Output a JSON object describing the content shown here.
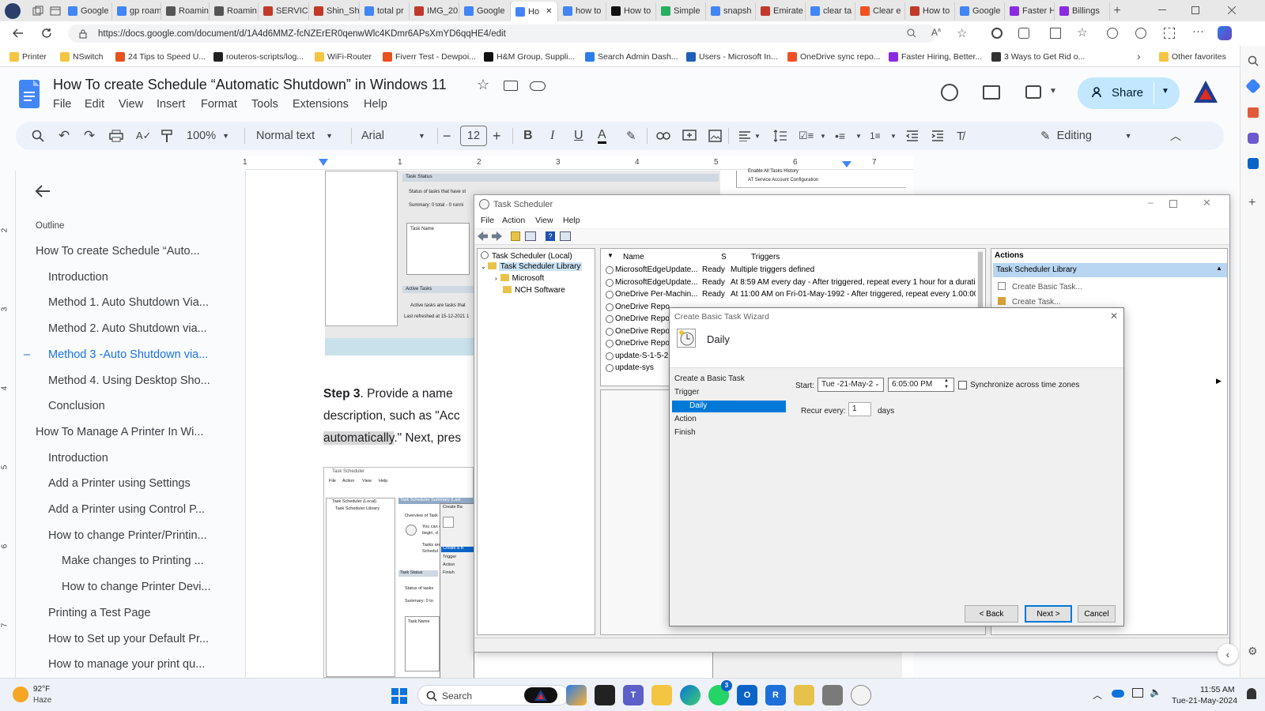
{
  "browser": {
    "tabs": [
      {
        "label": "Google"
      },
      {
        "label": "gp roam"
      },
      {
        "label": "Roamin"
      },
      {
        "label": "Roamin"
      },
      {
        "label": "SERVIC"
      },
      {
        "label": "Shin_Sh"
      },
      {
        "label": "total pr"
      },
      {
        "label": "IMG_20"
      },
      {
        "label": "Google"
      },
      {
        "label": "Ho"
      },
      {
        "label": "how to"
      },
      {
        "label": "How to"
      },
      {
        "label": "Simple"
      },
      {
        "label": "snapsh"
      },
      {
        "label": "Emirate"
      },
      {
        "label": "clear ta"
      },
      {
        "label": "Clear e"
      },
      {
        "label": "How to"
      },
      {
        "label": "Google"
      },
      {
        "label": "Faster H"
      },
      {
        "label": "Billings"
      }
    ],
    "url": "https://docs.google.com/document/d/1A4d6MMZ-fcNZErER0qenwWlc4KDmr6APsXmYD6qqHE4/edit",
    "bookmarks": [
      {
        "label": "Printer",
        "color": "#f4c542"
      },
      {
        "label": "NSwitch",
        "color": "#f4c542"
      },
      {
        "label": "24 Tips to Speed U...",
        "color": "#e8511b"
      },
      {
        "label": "routeros-scripts/log...",
        "color": "#222222"
      },
      {
        "label": "WiFi-Router",
        "color": "#f4c542"
      },
      {
        "label": "Fiverr Test - Dewpoi...",
        "color": "#e8511b"
      },
      {
        "label": "H&M Group, Suppli...",
        "color": "#111111"
      },
      {
        "label": "Search Admin Dash...",
        "color": "#2b7de9"
      },
      {
        "label": "Users - Microsoft In...",
        "color": "#1e5fb8"
      },
      {
        "label": "OneDrive sync repo...",
        "color": "#f25022"
      },
      {
        "label": "Faster Hiring, Better...",
        "color": "#8a2be2"
      },
      {
        "label": "3 Ways to Get Rid o...",
        "color": "#333333"
      }
    ],
    "other_favorites": "Other favorites"
  },
  "doc": {
    "title": "How To create Schedule “Automatic Shutdown” in Windows 11",
    "menu": [
      "File",
      "Edit",
      "View",
      "Insert",
      "Format",
      "Tools",
      "Extensions",
      "Help"
    ],
    "share": "Share",
    "zoom": "100%",
    "style": "Normal text",
    "font": "Arial",
    "font_size": "12",
    "mode": "Editing",
    "ruler_numbers": [
      "1",
      "1",
      "2",
      "3",
      "4",
      "5",
      "6",
      "7"
    ],
    "vruler_numbers": [
      "2",
      "3",
      "4",
      "5",
      "6",
      "7"
    ]
  },
  "outline": {
    "heading": "Outline",
    "items": [
      {
        "label": "How To create Schedule “Auto...",
        "level": 1
      },
      {
        "label": "Introduction",
        "level": 2
      },
      {
        "label": "Method 1. Auto Shutdown Via...",
        "level": 2
      },
      {
        "label": "Method 2. Auto Shutdown via...",
        "level": 2
      },
      {
        "label": "Method 3 -Auto Shutdown via...",
        "level": 2,
        "active": true
      },
      {
        "label": "Method 4. Using Desktop Sho...",
        "level": 2
      },
      {
        "label": "Conclusion",
        "level": 2
      },
      {
        "label": "How To Manage A Printer In Wi...",
        "level": 1
      },
      {
        "label": "Introduction",
        "level": 2
      },
      {
        "label": "Add a Printer using Settings",
        "level": 2
      },
      {
        "label": "Add a Printer using Control P...",
        "level": 2
      },
      {
        "label": "How to change Printer/Printin...",
        "level": 2
      },
      {
        "label": "Make changes to Printing ...",
        "level": 3
      },
      {
        "label": "How to change Printer Devi...",
        "level": 3
      },
      {
        "label": "Printing a Test Page",
        "level": 2
      },
      {
        "label": "How to Set up your Default Pr...",
        "level": 2
      },
      {
        "label": "How to manage your print qu...",
        "level": 2
      }
    ]
  },
  "body": {
    "step_bold": "Step 3",
    "line1_rest": ". Provide a name",
    "line2": "description, such as \"Acc",
    "line3_hl": "automatically",
    "line3_rest": ".\" Next, pres",
    "bg_img1": {
      "task_status": "Task Status",
      "status_text": "Status of tasks that have st",
      "summary": "Summary: 0 total - 0 runni",
      "task_name": "Task Name",
      "active_tasks": "Active Tasks",
      "active_text": "Active tasks are tasks that",
      "refreshed": "Last refreshed at 15-12-2021 1",
      "hist1": "Enable All Tasks History",
      "hist2": "AT Service Account Configuration"
    },
    "bg_img2": {
      "title": "Task Scheduler",
      "menu": [
        "File",
        "Action",
        "View",
        "Help"
      ],
      "tree1": "Task Scheduler (Local)",
      "tree2": "Task Scheduler Library",
      "summary": "Task Scheduler Summary (Last",
      "overview": "Overview of Task",
      "you_can": "You can c",
      "begin": "begin, cl",
      "tasks_are": "Tasks are",
      "sched": "Schedul",
      "wiz_title": "Create Ba",
      "steps": [
        "Create a B",
        "Trigger",
        "Action",
        "Finish"
      ],
      "task_status": "Task Status",
      "status_text": "Status of tasks",
      "summary2": "Summary: 0 to",
      "task_name": "Task Name"
    }
  },
  "task_scheduler": {
    "title": "Task Scheduler",
    "menu": [
      "File",
      "Action",
      "View",
      "Help"
    ],
    "tree": [
      "Task Scheduler (Local)",
      "Task Scheduler Library",
      "Microsoft",
      "NCH Software"
    ],
    "columns": [
      "Name",
      "S",
      "Triggers"
    ],
    "rows": [
      {
        "name": "MicrosoftEdgeUpdate...",
        "status": "Ready",
        "trigger": "Multiple triggers defined"
      },
      {
        "name": "MicrosoftEdgeUpdate...",
        "status": "Ready",
        "trigger": "At 8:59 AM every day - After triggered, repeat every 1 hour for a duratic"
      },
      {
        "name": "OneDrive Per-Machin...",
        "status": "Ready",
        "trigger": "At 11:00 AM on Fri-01-May-1992 - After triggered, repeat every 1.00:00:"
      },
      {
        "name": "OneDrive Repo",
        "status": "",
        "trigger": ""
      },
      {
        "name": "OneDrive Repo",
        "status": "",
        "trigger": ""
      },
      {
        "name": "OneDrive Repo",
        "status": "",
        "trigger": ""
      },
      {
        "name": "OneDrive Repo",
        "status": "",
        "trigger": ""
      },
      {
        "name": "update-S-1-5-2",
        "status": "",
        "trigger": ""
      },
      {
        "name": "update-sys",
        "status": "",
        "trigger": ""
      }
    ],
    "actions_header": "Actions",
    "actions_group": "Task Scheduler Library",
    "actions": [
      "Create Basic Task...",
      "Create Task..."
    ]
  },
  "wizard": {
    "title": "Create Basic Task Wizard",
    "heading": "Daily",
    "steps": [
      "Create a Basic Task",
      "Trigger",
      "Daily",
      "Action",
      "Finish"
    ],
    "active_step": "Daily",
    "start_label": "Start:",
    "start_date": "Tue -21-May-2",
    "start_time": "6:05:00 PM",
    "sync_label": "Synchronize across time zones",
    "sync_checked": false,
    "recur_label": "Recur every:",
    "recur_value": "1",
    "recur_unit": "days",
    "back": "< Back",
    "next": "Next >",
    "cancel": "Cancel"
  },
  "taskbar": {
    "weather_temp": "92°F",
    "weather_desc": "Haze",
    "search": "Search",
    "notification_badge": "3",
    "time": "11:55 AM",
    "date": "Tue-21-May-2024"
  }
}
